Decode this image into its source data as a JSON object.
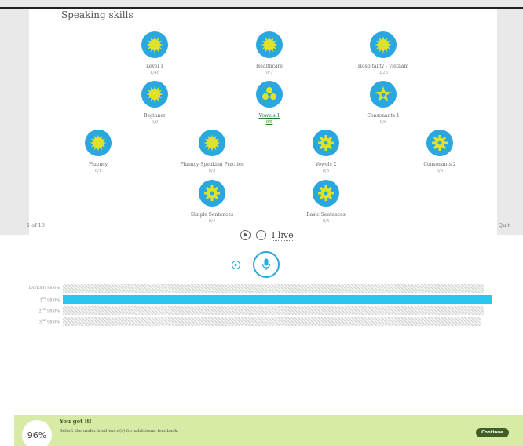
{
  "course": {
    "title": "Speaking skills",
    "lessons": [
      {
        "name": "Level 1",
        "progress": "1/48",
        "icon": "sun-icon",
        "active": false
      },
      {
        "name": "Healthcare",
        "progress": "0/7",
        "icon": "sun-icon",
        "active": false
      },
      {
        "name": "Hospitality - Vietnam",
        "progress": "0/23",
        "icon": "sun-icon",
        "active": false
      },
      {
        "name": "Beginner",
        "progress": "0/9",
        "icon": "sun-icon",
        "active": false
      },
      {
        "name": "Vowels 1",
        "progress": "0/5",
        "icon": "shapes-icon",
        "active": true
      },
      {
        "name": "Consonants 1",
        "progress": "0/6",
        "icon": "star-icon",
        "active": false
      },
      {
        "name": "Fluency",
        "progress": "0/1",
        "icon": "sun-icon",
        "active": false
      },
      {
        "name": "Fluency Speaking Practice",
        "progress": "0/3",
        "icon": "sun-icon",
        "active": false
      },
      {
        "name": "Vowels 2",
        "progress": "0/5",
        "icon": "gear-icon",
        "active": false
      },
      {
        "name": "Consonants 2",
        "progress": "0/6",
        "icon": "gear-icon",
        "active": false
      },
      {
        "name": "Simple Sentences",
        "progress": "0/4",
        "icon": "gear-icon",
        "active": false
      },
      {
        "name": "Basic Sentences",
        "progress": "0/5",
        "icon": "gear-icon",
        "active": false
      }
    ]
  },
  "pager": {
    "position": "1 of 18",
    "quit_label": "Quit"
  },
  "exercise": {
    "word": "I live",
    "info_label": "i"
  },
  "scores": [
    {
      "prefix": "LATEST:",
      "rank": "",
      "suffix": "",
      "value": "98.0%",
      "highlight": false,
      "fraction": 0.98
    },
    {
      "prefix": "",
      "rank": "1",
      "suffix": "ST",
      "value": "98.0%",
      "highlight": true,
      "fraction": 1.0
    },
    {
      "prefix": "",
      "rank": "2",
      "suffix": "ND",
      "value": "98.0%",
      "highlight": false,
      "fraction": 0.98
    },
    {
      "prefix": "",
      "rank": "3",
      "suffix": "RD",
      "value": "98.0%",
      "highlight": false,
      "fraction": 0.975
    }
  ],
  "feedback": {
    "score": "96%",
    "title": "You got it!",
    "message": "Select the underlined word(s) for additional feedback.",
    "continue_label": "Continue"
  },
  "colors": {
    "accent": "#2aa7de",
    "icon_fill": "#e0e22a",
    "feedback_bg": "#d7eba6",
    "bar_highlight": "#29c6ef",
    "button": "#3e5e24"
  }
}
